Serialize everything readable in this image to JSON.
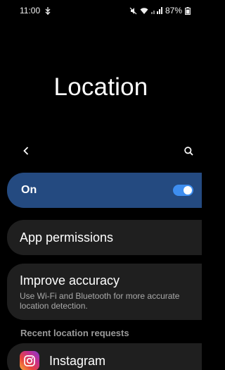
{
  "status_bar": {
    "time": "11:00",
    "battery": "87%",
    "left_icons": [
      "usb-debug-icon"
    ],
    "right_icons": [
      "mute-icon",
      "wifi-icon",
      "signal-icon",
      "battery-icon"
    ]
  },
  "header": {
    "title": "Location",
    "back_icon": "back-arrow-icon",
    "search_icon": "search-icon"
  },
  "master_toggle": {
    "label": "On",
    "state": true,
    "accent_color": "#3e8ef0",
    "card_color": "#244a80"
  },
  "settings": [
    {
      "title": "App permissions"
    },
    {
      "title": "Improve accuracy",
      "subtitle": "Use Wi-Fi and Bluetooth for more accurate location detection."
    }
  ],
  "recent": {
    "section_label": "Recent location requests",
    "apps": [
      {
        "name": "Instagram",
        "icon": "instagram-icon"
      }
    ]
  }
}
